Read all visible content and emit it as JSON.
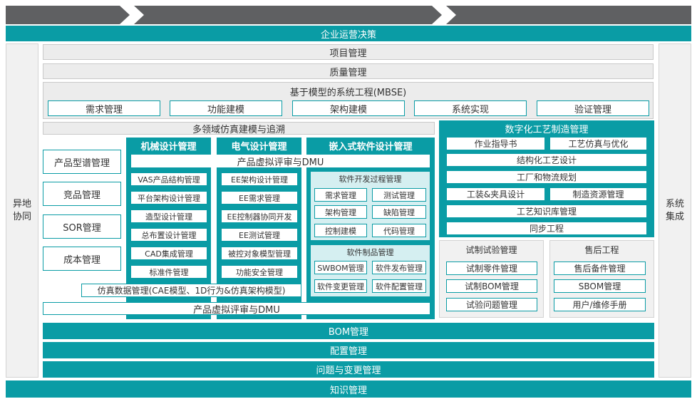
{
  "top_title": "企业运营决策",
  "left_side": "异地\n协同",
  "right_side": "系统\n集成",
  "project_mgmt": "项目管理",
  "quality_mgmt": "质量管理",
  "mbse": {
    "title": "基于模型的系统工程(MBSE)",
    "items": [
      "需求管理",
      "功能建模",
      "架构建模",
      "系统实现",
      "验证管理"
    ]
  },
  "multi_domain": "多领域仿真建模与追溯",
  "left_boxes": [
    "产品型谱管理",
    "竞品管理",
    "SOR管理",
    "成本管理"
  ],
  "mech": {
    "title": "机械设计管理",
    "items": [
      "VAS产品结构管理",
      "平台架构设计管理",
      "造型设计管理",
      "总布置设计管理",
      "CAD集成管理",
      "标准件管理"
    ]
  },
  "elec": {
    "title": "电气设计管理",
    "items": [
      "EE架构设计管理",
      "EE需求管理",
      "EE控制器协同开发",
      "EE测试管理",
      "被控对象模型管理",
      "功能安全管理"
    ]
  },
  "emb": {
    "title": "嵌入式软件设计管理",
    "dev_title": "软件开发过程管理",
    "dev_items": [
      "需求管理",
      "测试管理",
      "架构管理",
      "缺陷管理",
      "控制建模",
      "代码管理"
    ],
    "prod_title": "软件制品管理",
    "prod_items": [
      "SWBOM管理",
      "软件发布管理",
      "软件变更管理",
      "软件配置管理"
    ]
  },
  "dmu_top": "产品虚拟评审与DMU",
  "sim_data": "仿真数据管理(CAE模型、1D行为&仿真架构模型)",
  "dmu_bottom": "产品虚拟评审与DMU",
  "digital": {
    "title": "数字化工艺制造管理",
    "row1": [
      "作业指导书",
      "工艺仿真与优化"
    ],
    "full": [
      "结构化工艺设计",
      "工厂和物流规划"
    ],
    "row2": [
      "工装&夹具设计",
      "制造资源管理"
    ],
    "full2": [
      "工艺知识库管理",
      "同步工程"
    ]
  },
  "trial": {
    "title": "试制试验管理",
    "items": [
      "试制零件管理",
      "试制BOM管理",
      "试验问题管理"
    ]
  },
  "after": {
    "title": "售后工程",
    "items": [
      "售后备件管理",
      "SBOM管理",
      "用户/维修手册"
    ]
  },
  "bom": "BOM管理",
  "config": "配置管理",
  "issue": "问题与变更管理",
  "knowledge": "知识管理"
}
